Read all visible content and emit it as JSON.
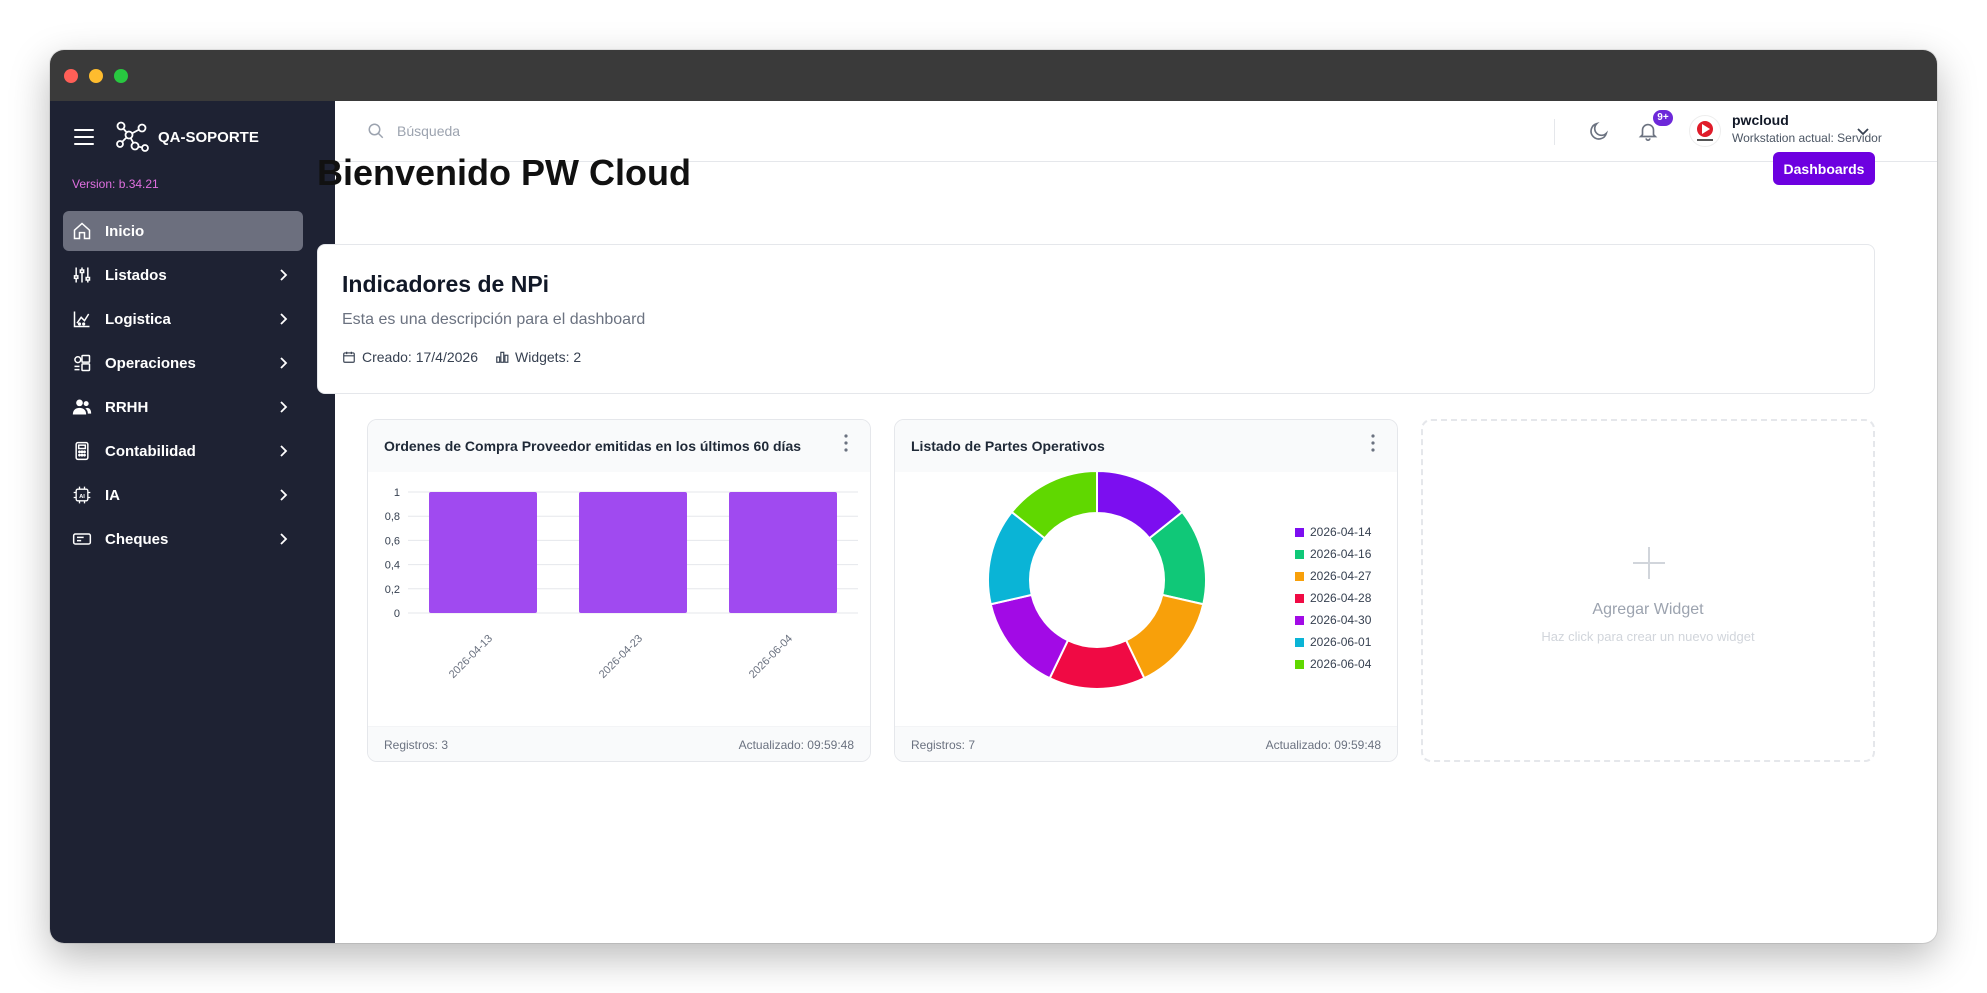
{
  "sidebar": {
    "brand": "QA-SOPORTE",
    "version": "Version: b.34.21",
    "items": [
      {
        "label": "Inicio"
      },
      {
        "label": "Listados"
      },
      {
        "label": "Logistica"
      },
      {
        "label": "Operaciones"
      },
      {
        "label": "RRHH"
      },
      {
        "label": "Contabilidad"
      },
      {
        "label": "IA"
      },
      {
        "label": "Cheques"
      }
    ]
  },
  "header": {
    "search_placeholder": "Búsqueda",
    "notification_count": "9+",
    "user_name": "pwcloud",
    "workstation": "Workstation actual: Servidor"
  },
  "main": {
    "title": "Bienvenido PW Cloud",
    "dashboards_button": "Dashboards",
    "dashboard": {
      "name": "Indicadores de NPi",
      "description": "Esta es una descripción para el dashboard",
      "created": "Creado: 17/4/2026",
      "widgets": "Widgets: 2"
    },
    "add_widget": {
      "title": "Agregar Widget",
      "subtitle": "Haz click para crear un nuevo widget"
    }
  },
  "widgets": [
    {
      "title": "Ordenes de Compra Proveedor emitidas en los últimos 60 días",
      "records": "Registros: 3",
      "updated": "Actualizado: 09:59:48"
    },
    {
      "title": "Listado de Partes Operativos",
      "records": "Registros: 7",
      "updated": "Actualizado: 09:59:48"
    }
  ],
  "chart_data": [
    {
      "type": "bar",
      "title": "Ordenes de Compra Proveedor emitidas en los últimos 60 días",
      "categories": [
        "2026-04-13",
        "2026-04-23",
        "2026-06-04"
      ],
      "values": [
        1,
        1,
        1
      ],
      "ylim": [
        0,
        1
      ],
      "yticks": [
        "0",
        "0,2",
        "0,4",
        "0,6",
        "0,8",
        "1"
      ],
      "color": "#a04af0",
      "grid": true
    },
    {
      "type": "pie",
      "donut": true,
      "title": "Listado de Partes Operativos",
      "legend_position": "right",
      "labels": [
        "2026-04-14",
        "2026-04-16",
        "2026-04-27",
        "2026-04-28",
        "2026-04-30",
        "2026-06-01",
        "2026-06-04"
      ],
      "values": [
        1,
        1,
        1,
        1,
        1,
        1,
        1
      ],
      "colors": [
        "#7c0ef0",
        "#10c878",
        "#f8a00a",
        "#f00a44",
        "#a20ae6",
        "#0ab4d6",
        "#60d800"
      ]
    }
  ]
}
